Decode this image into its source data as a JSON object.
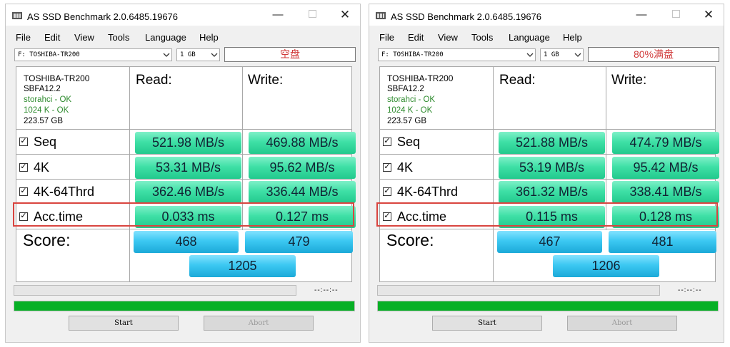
{
  "windows": [
    {
      "title": "AS SSD Benchmark 2.0.6485.19676",
      "menu": [
        "File",
        "Edit",
        "View",
        "Tools",
        "Language",
        "Help"
      ],
      "drive_select": "F: TOSHIBA-TR200",
      "size_select": "1 GB",
      "label": "空盘",
      "drive_info": {
        "name": "TOSHIBA-TR200",
        "firmware": "SBFA12.2",
        "driver": "storahci - OK",
        "alignment": "1024 K - OK",
        "capacity": "223.57 GB"
      },
      "headers": {
        "read": "Read:",
        "write": "Write:"
      },
      "rows": [
        {
          "label": "Seq",
          "read": "521.98 MB/s",
          "write": "469.88 MB/s"
        },
        {
          "label": "4K",
          "read": "53.31 MB/s",
          "write": "95.62 MB/s"
        },
        {
          "label": "4K-64Thrd",
          "read": "362.46 MB/s",
          "write": "336.44 MB/s"
        },
        {
          "label": "Acc.time",
          "read": "0.033 ms",
          "write": "0.127 ms"
        }
      ],
      "score": {
        "label": "Score:",
        "read": "468",
        "write": "479",
        "total": "1205"
      },
      "timer": "--:--:--",
      "buttons": {
        "start": "Start",
        "abort": "Abort"
      }
    },
    {
      "title": "AS SSD Benchmark 2.0.6485.19676",
      "menu": [
        "File",
        "Edit",
        "View",
        "Tools",
        "Language",
        "Help"
      ],
      "drive_select": "F: TOSHIBA-TR200",
      "size_select": "1 GB",
      "label": "80%满盘",
      "drive_info": {
        "name": "TOSHIBA-TR200",
        "firmware": "SBFA12.2",
        "driver": "storahci - OK",
        "alignment": "1024 K - OK",
        "capacity": "223.57 GB"
      },
      "headers": {
        "read": "Read:",
        "write": "Write:"
      },
      "rows": [
        {
          "label": "Seq",
          "read": "521.88 MB/s",
          "write": "474.79 MB/s"
        },
        {
          "label": "4K",
          "read": "53.19 MB/s",
          "write": "95.42 MB/s"
        },
        {
          "label": "4K-64Thrd",
          "read": "361.32 MB/s",
          "write": "338.41 MB/s"
        },
        {
          "label": "Acc.time",
          "read": "0.115 ms",
          "write": "0.128 ms"
        }
      ],
      "score": {
        "label": "Score:",
        "read": "467",
        "write": "481",
        "total": "1206"
      },
      "timer": "--:--:--",
      "buttons": {
        "start": "Start",
        "abort": "Abort"
      }
    }
  ],
  "colors": {
    "result_green": "#3fe0a6",
    "score_blue": "#3cc8f2",
    "progress_green": "#06b025",
    "highlight_red": "#d9443f",
    "ok_text": "#2e8b2e"
  }
}
